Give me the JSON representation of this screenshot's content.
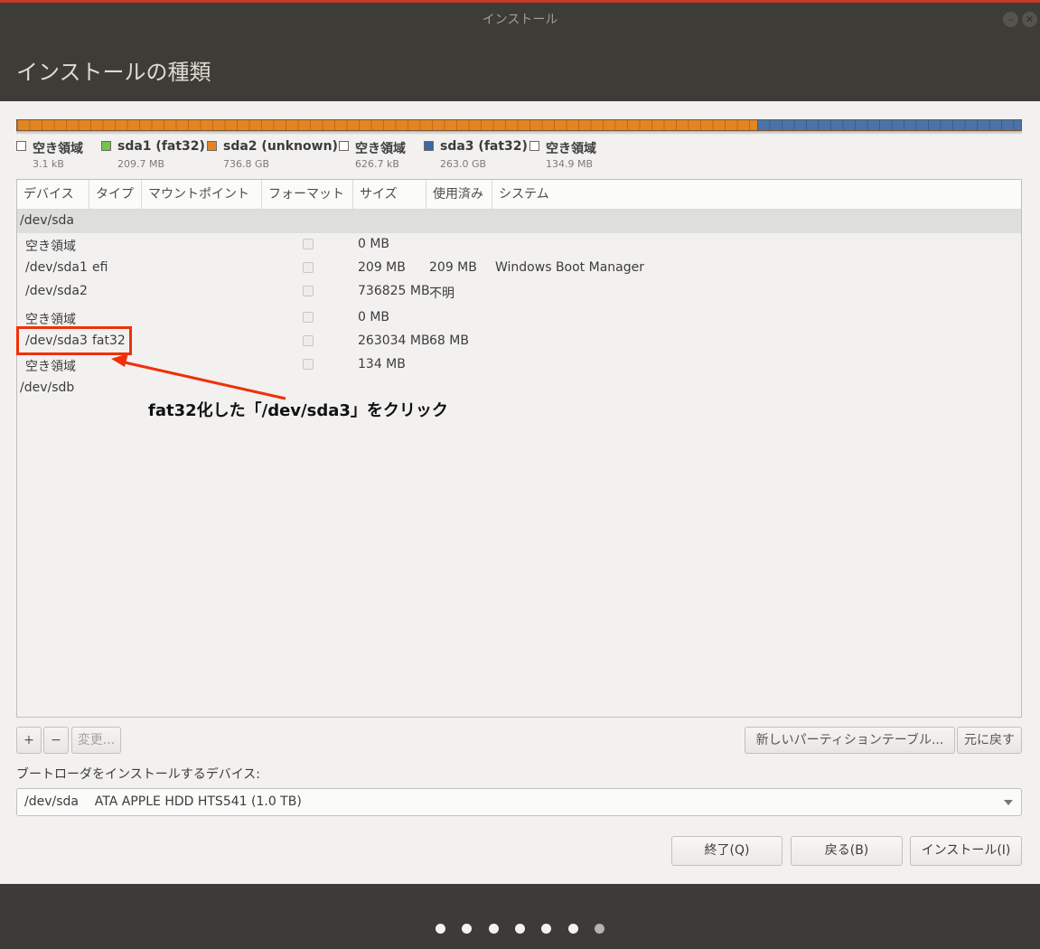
{
  "window": {
    "title": "インストール",
    "page_title": "インストールの種類",
    "colors": {
      "accent_top": "#c0392b",
      "annotation": "#f0300a"
    }
  },
  "partition_bar": {
    "segments": [
      {
        "name": "sda2 (unknown)",
        "fraction": 0.737,
        "color": "#e38522"
      },
      {
        "name": "sda3 (fat32)",
        "fraction": 0.263,
        "color": "#4b73a9"
      }
    ]
  },
  "legend": [
    {
      "name": "空き領域",
      "size": "3.1 kB",
      "color": "#ffffff"
    },
    {
      "name": "sda1 (fat32)",
      "size": "209.7 MB",
      "color": "#73c44a"
    },
    {
      "name": "sda2 (unknown)",
      "size": "736.8 GB",
      "color": "#e38522"
    },
    {
      "name": "空き領域",
      "size": "626.7 kB",
      "color": "#ffffff"
    },
    {
      "name": "sda3 (fat32)",
      "size": "263.0 GB",
      "color": "#3f67a4"
    },
    {
      "name": "空き領域",
      "size": "134.9 MB",
      "color": "#ffffff"
    }
  ],
  "table": {
    "columns": [
      "デバイス",
      "タイプ",
      "マウントポイント",
      "フォーマット",
      "サイズ",
      "使用済み",
      "システム"
    ],
    "rows": [
      {
        "device": "/dev/sda",
        "type": "",
        "size": "",
        "used": "",
        "system": ""
      },
      {
        "device": "空き領域",
        "type": "",
        "size": "0 MB",
        "used": "",
        "system": ""
      },
      {
        "device": "/dev/sda1",
        "type": "efi",
        "size": "209 MB",
        "used": "209 MB",
        "system": "Windows Boot Manager"
      },
      {
        "device": "/dev/sda2",
        "type": "",
        "size": "736825 MB",
        "used": "不明",
        "system": ""
      },
      {
        "device": "空き領域",
        "type": "",
        "size": "0 MB",
        "used": "",
        "system": ""
      },
      {
        "device": "/dev/sda3",
        "type": "fat32",
        "size": "263034 MB",
        "used": "68 MB",
        "system": ""
      },
      {
        "device": "空き領域",
        "type": "",
        "size": "134 MB",
        "used": "",
        "system": ""
      },
      {
        "device": "/dev/sdb",
        "type": "",
        "size": "",
        "used": "",
        "system": ""
      }
    ]
  },
  "annotation": {
    "text": "fat32化した「/dev/sda3」をクリック"
  },
  "toolbar": {
    "add_label": "+",
    "remove_label": "−",
    "change_label": "変更...",
    "new_table_label": "新しいパーティションテーブル...",
    "revert_label": "元に戻す"
  },
  "bootloader": {
    "label": "ブートローダをインストールするデバイス:",
    "value": "/dev/sda    ATA APPLE HDD HTS541 (1.0 TB)"
  },
  "actions": {
    "quit_label": "終了(Q)",
    "back_label": "戻る(B)",
    "install_label": "インストール(I)"
  },
  "progress": {
    "total_steps": 7,
    "current_step": 6
  }
}
